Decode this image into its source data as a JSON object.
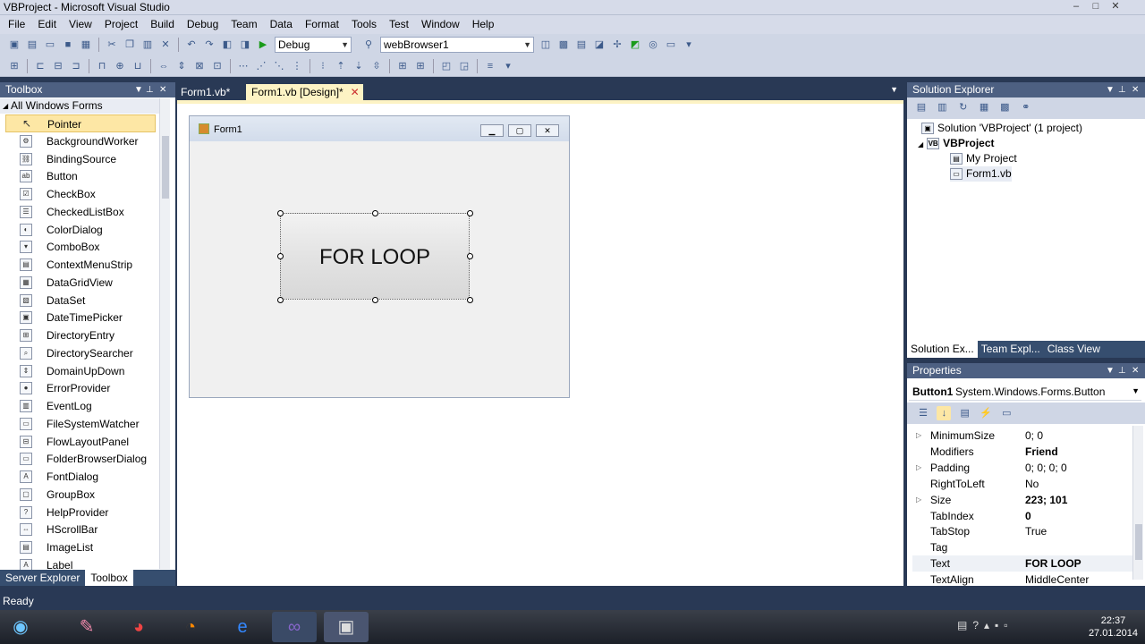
{
  "window": {
    "title": "VBProject - Microsoft Visual Studio",
    "min": "–",
    "max": "□",
    "close": "✕"
  },
  "menu": [
    "File",
    "Edit",
    "View",
    "Project",
    "Build",
    "Debug",
    "Team",
    "Data",
    "Format",
    "Tools",
    "Test",
    "Window",
    "Help"
  ],
  "toolbar": {
    "config": "Debug",
    "target": "webBrowser1"
  },
  "toolbox": {
    "title": "Toolbox",
    "category": "All Windows Forms",
    "items": [
      "Pointer",
      "BackgroundWorker",
      "BindingSource",
      "Button",
      "CheckBox",
      "CheckedListBox",
      "ColorDialog",
      "ComboBox",
      "ContextMenuStrip",
      "DataGridView",
      "DataSet",
      "DateTimePicker",
      "DirectoryEntry",
      "DirectorySearcher",
      "DomainUpDown",
      "ErrorProvider",
      "EventLog",
      "FileSystemWatcher",
      "FlowLayoutPanel",
      "FolderBrowserDialog",
      "FontDialog",
      "GroupBox",
      "HelpProvider",
      "HScrollBar",
      "ImageList",
      "Label"
    ],
    "selected_index": 0,
    "bottom_tabs": [
      "Server Explorer",
      "Toolbox"
    ]
  },
  "doc_tabs": [
    {
      "label": "Form1.vb*"
    },
    {
      "label": "Form1.vb [Design]*"
    }
  ],
  "form": {
    "title": "Form1",
    "button_text": "FOR LOOP"
  },
  "solution_explorer": {
    "title": "Solution Explorer",
    "solution": "Solution 'VBProject' (1 project)",
    "project": "VBProject",
    "items": [
      "My Project",
      "Form1.vb"
    ],
    "tabs": [
      "Solution Ex...",
      "Team Expl...",
      "Class View"
    ]
  },
  "properties": {
    "title": "Properties",
    "object": "Button1",
    "object_type": "System.Windows.Forms.Button",
    "rows": [
      {
        "name": "MinimumSize",
        "value": "0; 0",
        "bold": false,
        "expand": true
      },
      {
        "name": "Modifiers",
        "value": "Friend",
        "bold": true,
        "expand": false
      },
      {
        "name": "Padding",
        "value": "0; 0; 0; 0",
        "bold": false,
        "expand": true
      },
      {
        "name": "RightToLeft",
        "value": "No",
        "bold": false,
        "expand": false
      },
      {
        "name": "Size",
        "value": "223; 101",
        "bold": true,
        "expand": true
      },
      {
        "name": "TabIndex",
        "value": "0",
        "bold": true,
        "expand": false
      },
      {
        "name": "TabStop",
        "value": "True",
        "bold": false,
        "expand": false
      },
      {
        "name": "Tag",
        "value": "",
        "bold": false,
        "expand": false
      },
      {
        "name": "Text",
        "value": "FOR LOOP",
        "bold": true,
        "expand": false
      },
      {
        "name": "TextAlign",
        "value": "MiddleCenter",
        "bold": false,
        "expand": false
      }
    ]
  },
  "status": "Ready",
  "clock": {
    "time": "22:37",
    "date": "27.01.2014"
  },
  "colors": {
    "ide_dark": "#293955",
    "tab_active": "#fdf3c4",
    "selection": "#fde7a5"
  }
}
